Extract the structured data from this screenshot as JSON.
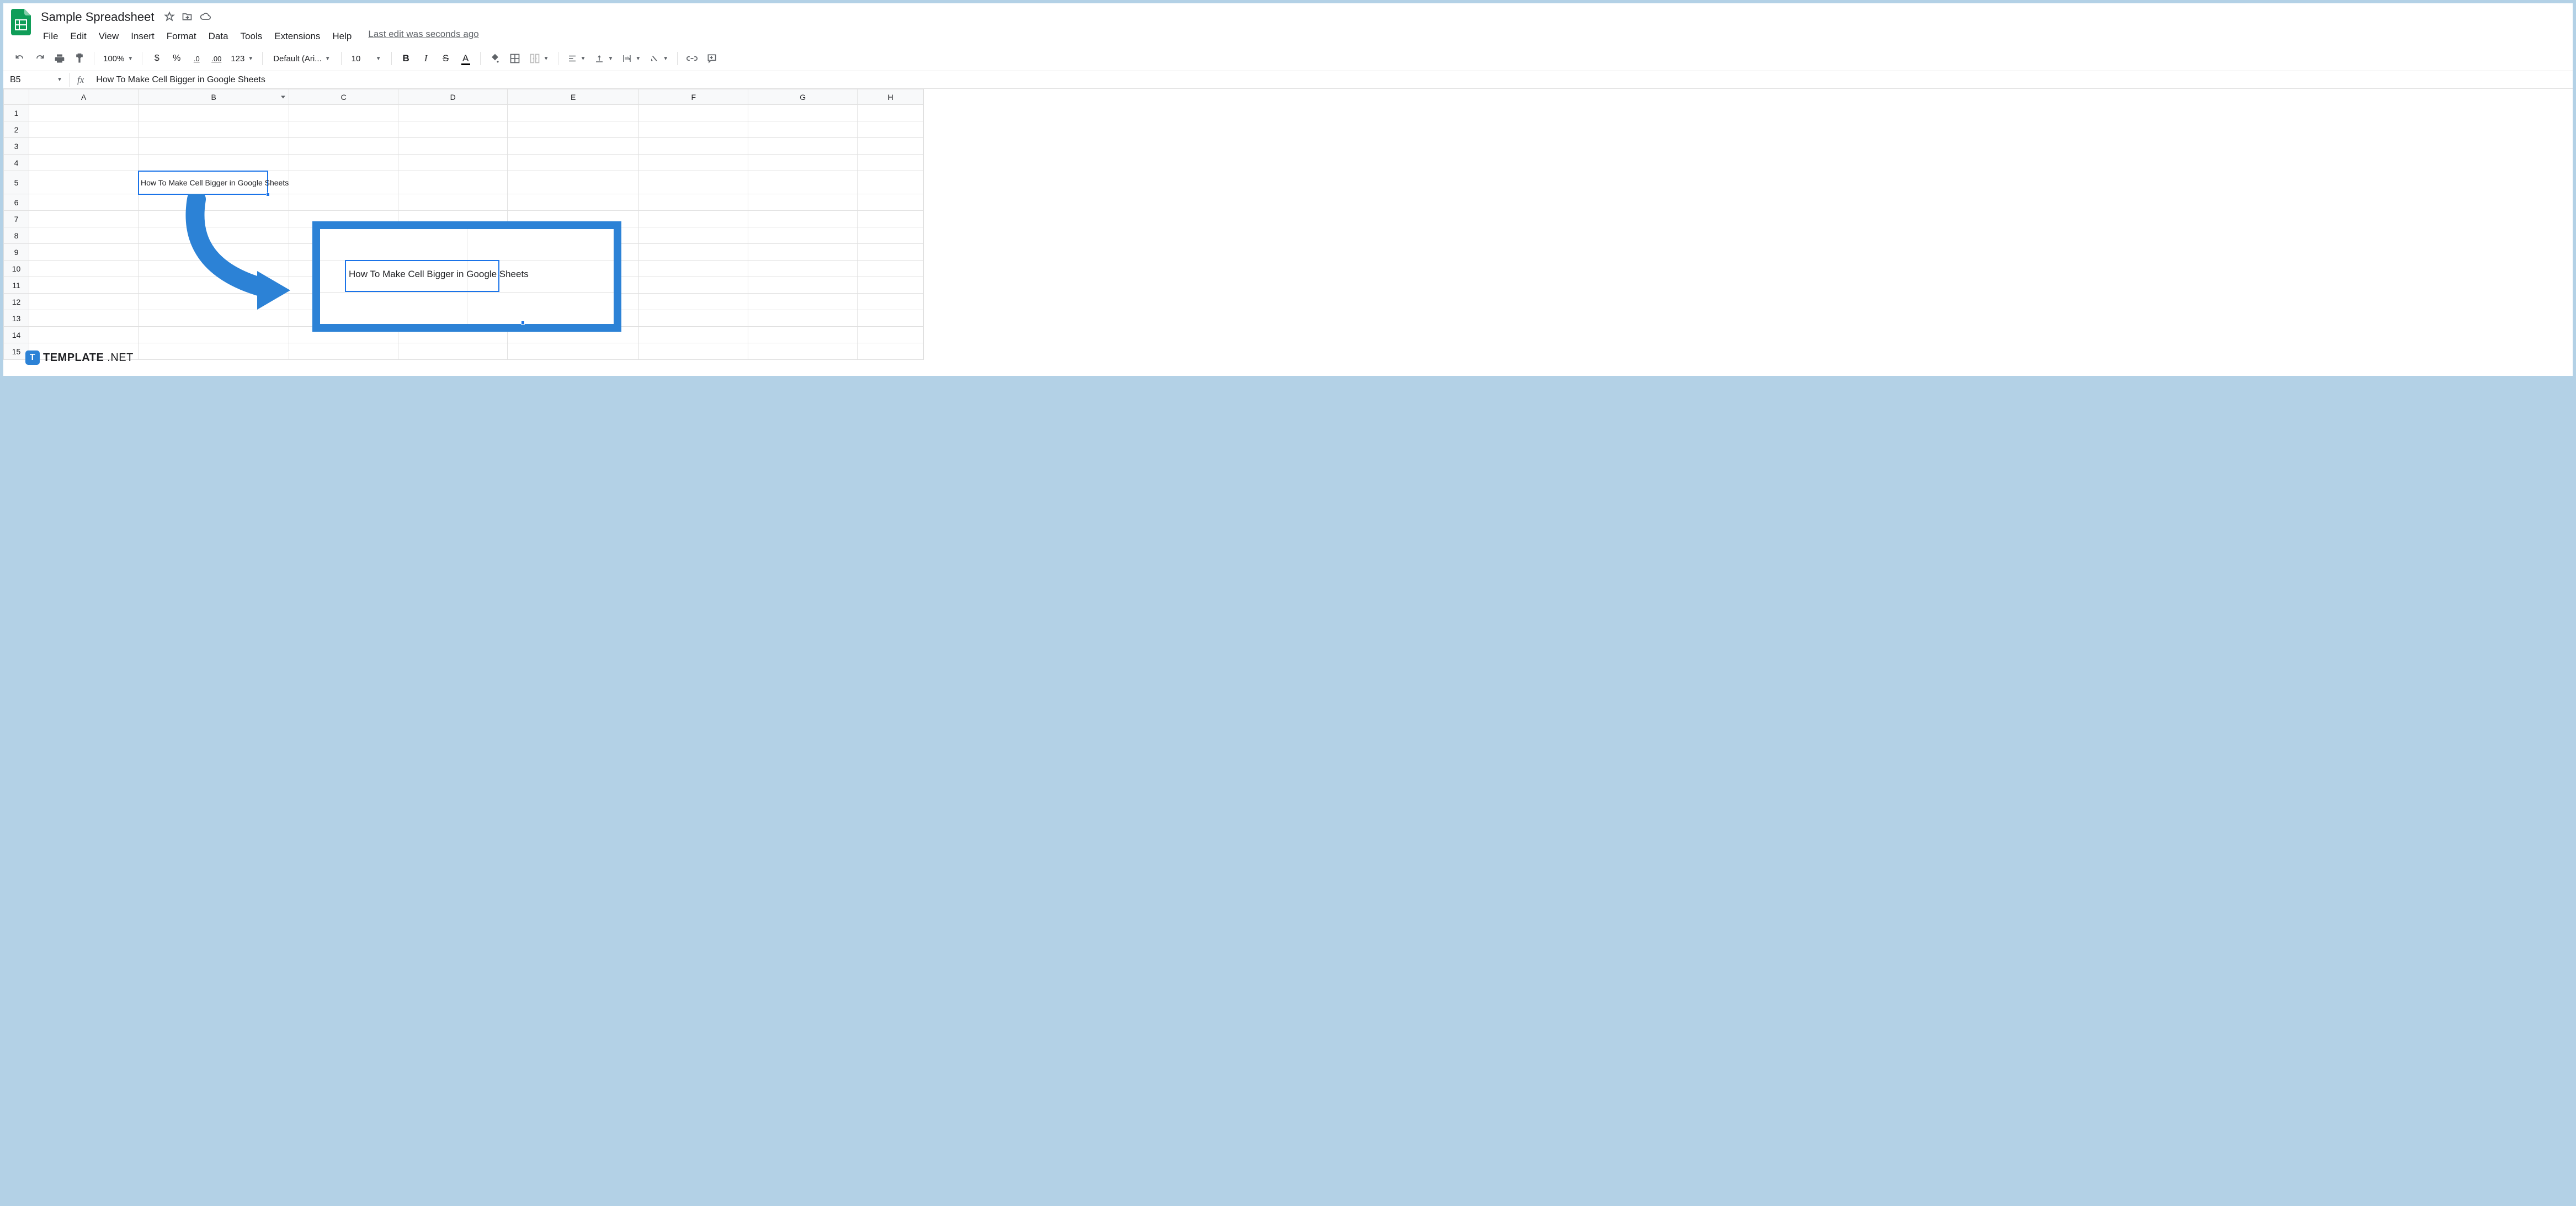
{
  "header": {
    "doc_title": "Sample Spreadsheet",
    "menus": [
      "File",
      "Edit",
      "View",
      "Insert",
      "Format",
      "Data",
      "Tools",
      "Extensions",
      "Help"
    ],
    "last_edit": "Last edit was seconds ago"
  },
  "toolbar": {
    "zoom": "100%",
    "currency": "$",
    "percent": "%",
    "dec_dec": ".0",
    "inc_dec": ".00",
    "num_fmt": "123",
    "font": "Default (Ari...",
    "font_size": "10"
  },
  "formula_bar": {
    "cell_ref": "B5",
    "fx_label": "fx",
    "formula": "How To Make Cell Bigger in Google Sheets"
  },
  "columns": [
    "A",
    "B",
    "C",
    "D",
    "E",
    "F",
    "G",
    "H"
  ],
  "rows": [
    "1",
    "2",
    "3",
    "4",
    "5",
    "6",
    "7",
    "8",
    "9",
    "10",
    "11",
    "12",
    "13",
    "14",
    "15"
  ],
  "cells": {
    "B5": "How To Make Cell Bigger in Google Sheets"
  },
  "callout": {
    "text": "How To Make Cell Bigger in Google Sheets"
  },
  "watermark": {
    "brand": "TEMPLATE",
    "suffix": ".NET",
    "logo_letter": "T"
  }
}
